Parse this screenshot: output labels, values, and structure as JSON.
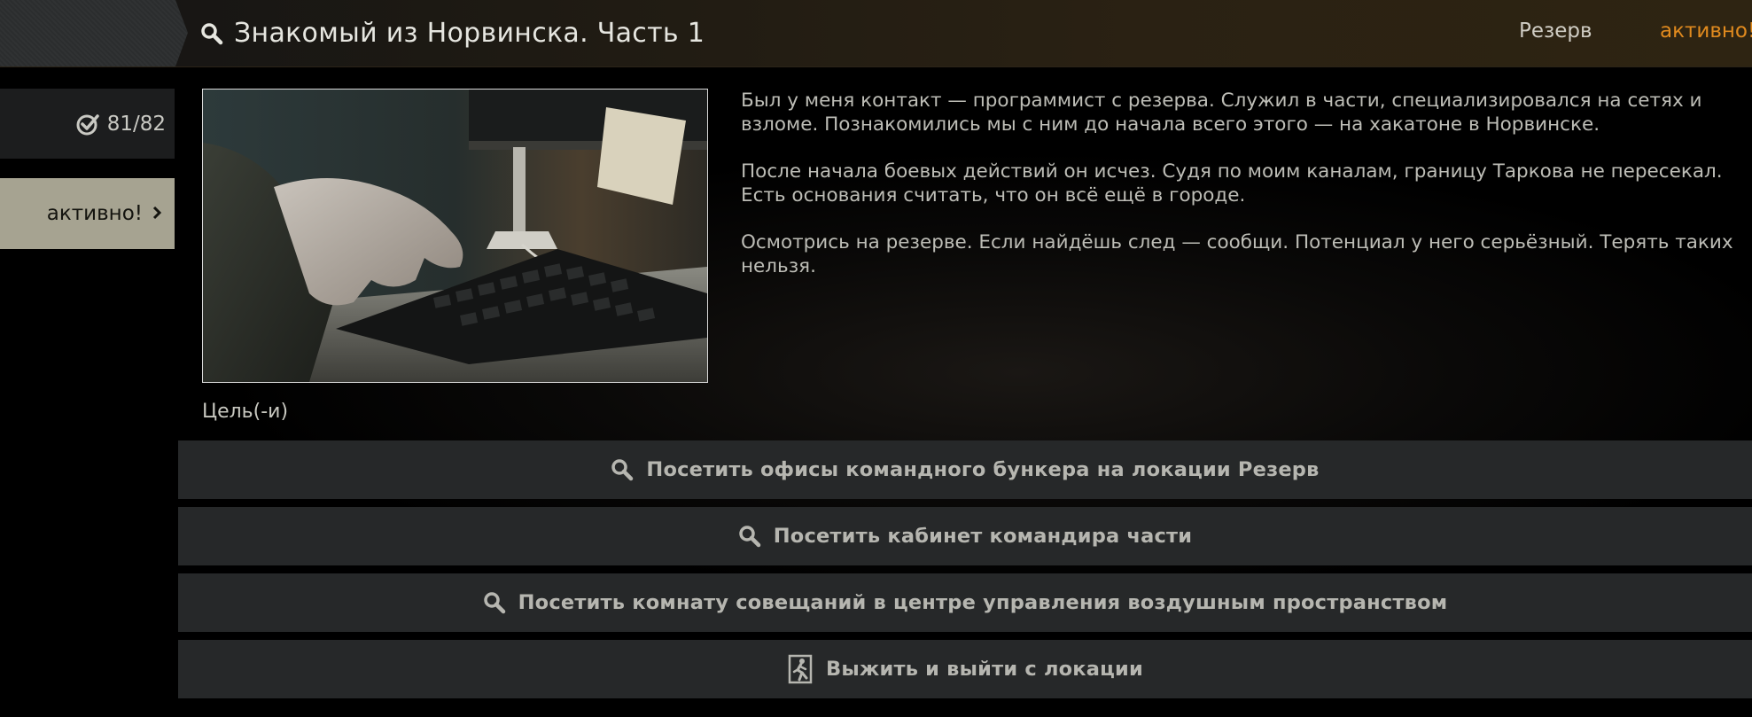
{
  "header": {
    "title": "Знакомый из Норвинска. Часть 1",
    "location": "Резерв",
    "status": "активно!",
    "status_color": "#e08a1e"
  },
  "sidebar": {
    "counter": "81/82",
    "status_tab_label": "активно!"
  },
  "description": {
    "paragraphs": [
      "Был у меня контакт — программист с резерва. Служил в части, специализировался на сетях и взломе. Познакомились мы с ним до начала всего этого — на хакатоне в Норвинске.",
      "После начала боевых действий он исчез. Судя по моим каналам, границу Таркова не пересекал. Есть основания считать, что он всё ещё в городе.",
      "Осмотрись на резерве. Если найдёшь след — сообщи. Потенциал у него серьёзный. Терять таких нельзя."
    ]
  },
  "objectives": {
    "heading": "Цель(-и)",
    "items": [
      {
        "icon": "search-icon",
        "label": "Посетить офисы командного бункера на локации Резерв"
      },
      {
        "icon": "search-icon",
        "label": "Посетить кабинет командира части"
      },
      {
        "icon": "search-icon",
        "label": "Посетить комнату совещаний в центре управления воздушным пространством"
      },
      {
        "icon": "exit-icon",
        "label": "Выжить и выйти с локации"
      }
    ]
  },
  "colors": {
    "objective_bg": "#262829",
    "status_tab_bg": "#a6a391"
  }
}
